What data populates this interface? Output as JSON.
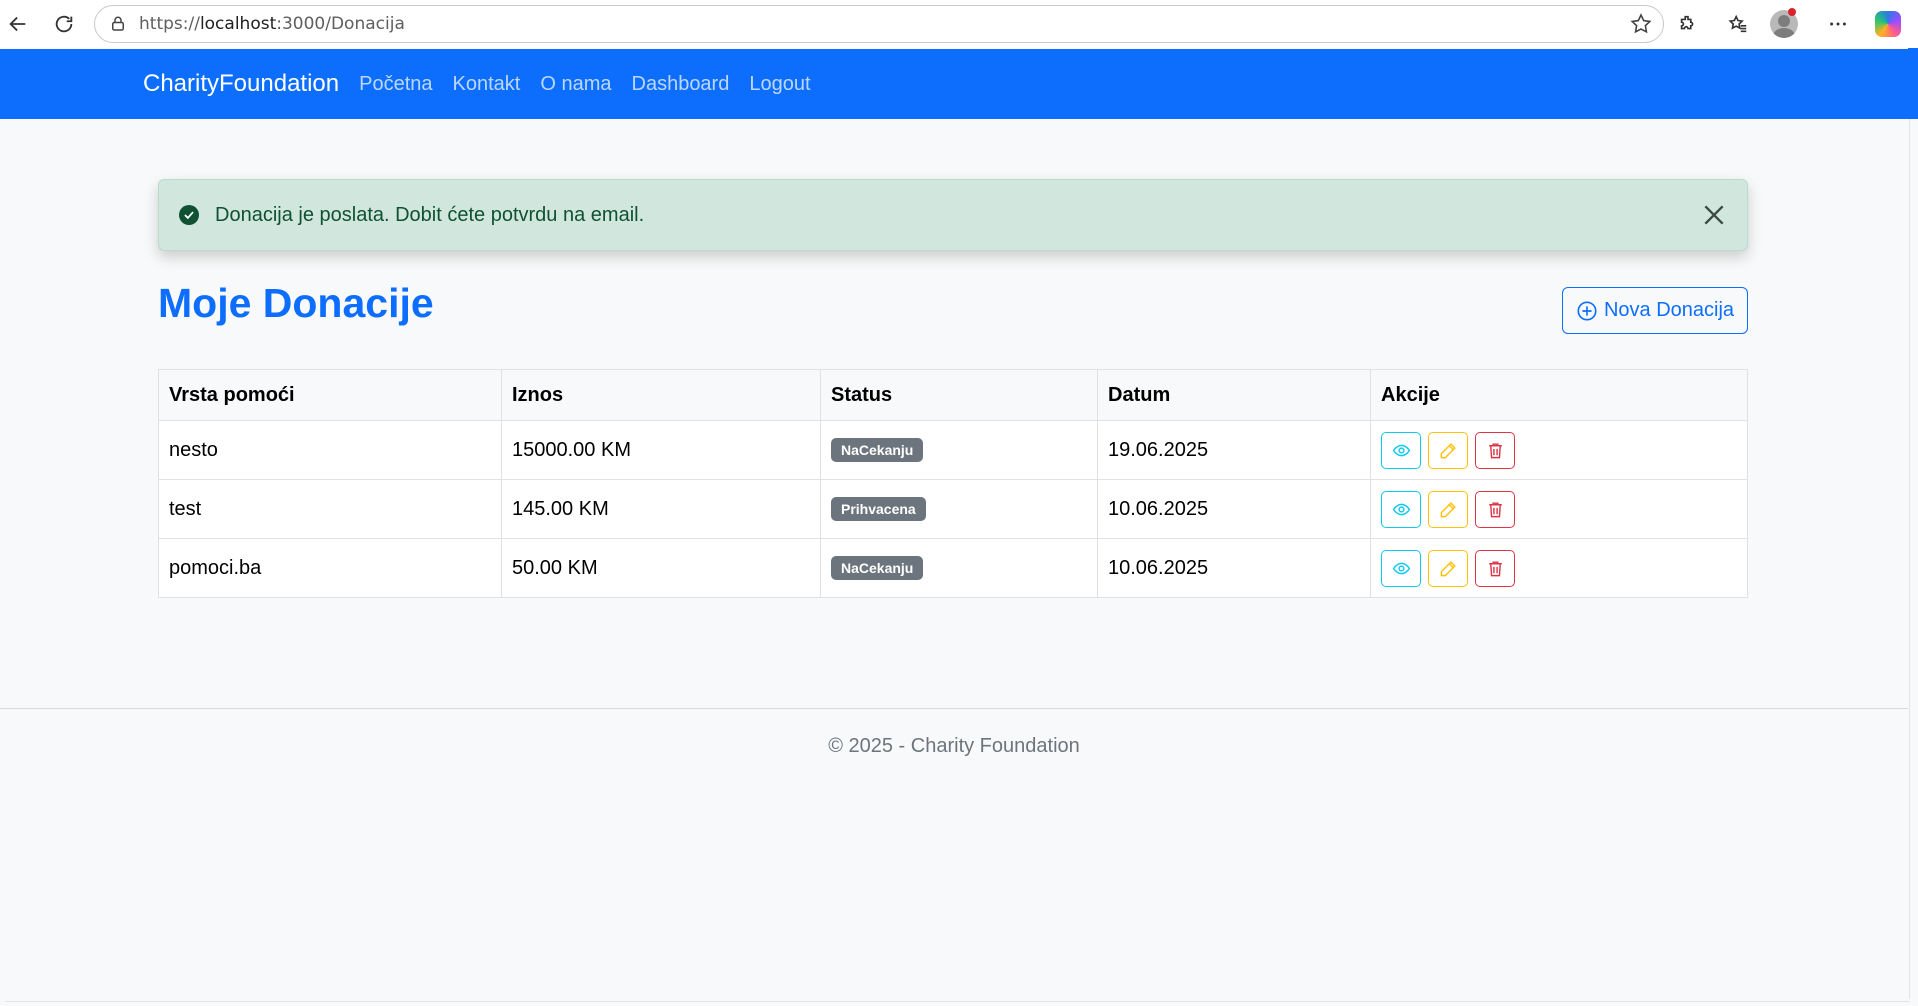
{
  "browser": {
    "url_prefix": "https://",
    "url_host": "localhost",
    "url_rest": ":3000/Donacija",
    "icons": [
      "back-arrow-icon",
      "reload-icon",
      "lock-icon",
      "star-icon",
      "extensions-icon",
      "favorites-icon",
      "profile-avatar",
      "more-icon",
      "copilot-icon"
    ]
  },
  "navbar": {
    "brand": "CharityFoundation",
    "links": [
      "Početna",
      "Kontakt",
      "O nama",
      "Dashboard",
      "Logout"
    ]
  },
  "alert": {
    "message": "Donacija je poslata. Dobit ćete potvrdu na email."
  },
  "page": {
    "title": "Moje Donacije",
    "new_button": "Nova Donacija"
  },
  "table": {
    "headers": [
      "Vrsta pomoći",
      "Iznos",
      "Status",
      "Datum",
      "Akcije"
    ],
    "rows": [
      {
        "type": "nesto",
        "amount": "15000.00 KM",
        "status": "NaCekanju",
        "date": "19.06.2025"
      },
      {
        "type": "test",
        "amount": "145.00 KM",
        "status": "Prihvacena",
        "date": "10.06.2025"
      },
      {
        "type": "pomoci.ba",
        "amount": "50.00 KM",
        "status": "NaCekanju",
        "date": "10.06.2025"
      }
    ]
  },
  "footer": {
    "text": "© 2025 - Charity Foundation"
  },
  "colors": {
    "primary": "#0d6efd",
    "success_bg": "#d1e7dd",
    "badge": "#6c757d",
    "info": "#0dcaf0",
    "warning": "#ffc107",
    "danger": "#dc3545"
  }
}
